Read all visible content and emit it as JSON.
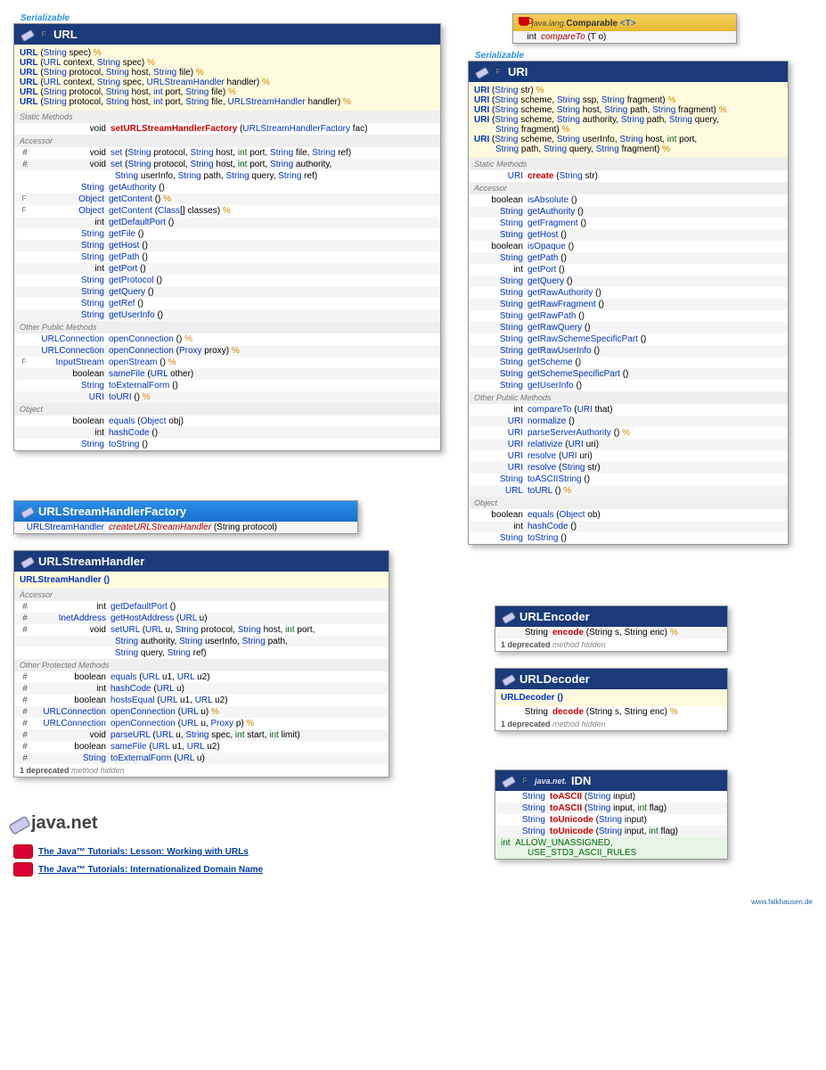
{
  "url_card": {
    "serial": "Serializable",
    "title": "URL",
    "f_marker": "F",
    "constructors": [
      [
        [
          "URL",
          " ("
        ],
        [
          "String",
          " spec) "
        ],
        [
          " %"
        ]
      ],
      [
        [
          "URL",
          " ("
        ],
        [
          "URL",
          " context, "
        ],
        [
          "String",
          " spec) "
        ],
        [
          " %"
        ]
      ],
      [
        [
          "URL",
          " ("
        ],
        [
          "String",
          " protocol, "
        ],
        [
          "String",
          " host, "
        ],
        [
          "String",
          " file) "
        ],
        [
          " %"
        ]
      ],
      [
        [
          "URL",
          " ("
        ],
        [
          "URL",
          " context, "
        ],
        [
          "String",
          " spec, "
        ],
        [
          "URLStreamHandler",
          " handler) "
        ],
        [
          " %"
        ]
      ],
      [
        [
          "URL",
          " ("
        ],
        [
          "String",
          " protocol, "
        ],
        [
          "String",
          " host, "
        ],
        [
          "int",
          " port, "
        ],
        [
          "String",
          " file) "
        ],
        [
          " %"
        ]
      ],
      [
        [
          "URL",
          " ("
        ],
        [
          "String",
          " protocol, "
        ],
        [
          "String",
          " host, "
        ],
        [
          "int",
          " port, "
        ],
        [
          "String",
          " file, "
        ],
        [
          "URLStreamHandler",
          " handler) "
        ],
        [
          " %"
        ]
      ]
    ],
    "static_label": "Static Methods",
    "static_rows": [
      {
        "hash": "",
        "ret": "void",
        "method": "setURLStreamHandlerFactory",
        "red": true,
        "args": " (URLStreamHandlerFactory fac)"
      }
    ],
    "accessor_label": "Accessor",
    "accessor_set": [
      {
        "hash": "#",
        "ret": "void",
        "method": "set",
        "args": " (String protocol, String host, int port, String file, String ref)"
      },
      {
        "hash": "#",
        "ret": "void",
        "method": "set",
        "args": " (String protocol, String host, int port, String authority,",
        "cont": "String userInfo, String path, String query, String ref)"
      }
    ],
    "accessor_rows": [
      {
        "ret": "String",
        "method": "getAuthority",
        "args": " ()"
      },
      {
        "f": "F",
        "ret": "Object",
        "method": "getContent",
        "args": " () ",
        "exc": "%"
      },
      {
        "f": "F",
        "ret": "Object",
        "method": "getContent",
        "args": " (Class[] classes) ",
        "exc": "%"
      },
      {
        "ret": "int",
        "method": "getDefaultPort",
        "args": " ()"
      },
      {
        "ret": "String",
        "method": "getFile",
        "args": " ()"
      },
      {
        "ret": "String",
        "method": "getHost",
        "args": " ()"
      },
      {
        "ret": "String",
        "method": "getPath",
        "args": " ()"
      },
      {
        "ret": "int",
        "method": "getPort",
        "args": " ()"
      },
      {
        "ret": "String",
        "method": "getProtocol",
        "args": " ()"
      },
      {
        "ret": "String",
        "method": "getQuery",
        "args": " ()"
      },
      {
        "ret": "String",
        "method": "getRef",
        "args": " ()"
      },
      {
        "ret": "String",
        "method": "getUserInfo",
        "args": " ()"
      }
    ],
    "other_label": "Other Public Methods",
    "other_rows": [
      {
        "ret": "URLConnection",
        "method": "openConnection",
        "args": " () ",
        "exc": "%"
      },
      {
        "ret": "URLConnection",
        "method": "openConnection",
        "args": " (Proxy proxy) ",
        "exc": "%"
      },
      {
        "f": "F",
        "ret": "InputStream",
        "method": "openStream",
        "args": " () ",
        "exc": "%"
      },
      {
        "ret": "boolean",
        "retg": true,
        "method": "sameFile",
        "args": " (URL other)"
      },
      {
        "ret": "String",
        "method": "toExternalForm",
        "args": " ()"
      },
      {
        "ret": "URI",
        "method": "toURI",
        "args": " () ",
        "exc": "%"
      }
    ],
    "object_label": "Object",
    "object_rows": [
      {
        "ret": "boolean",
        "retg": true,
        "method": "equals",
        "args": " (Object obj)"
      },
      {
        "ret": "int",
        "method": "hashCode",
        "args": " ()"
      },
      {
        "ret": "String",
        "method": "toString",
        "args": " ()"
      }
    ]
  },
  "factory_card": {
    "title": "URLStreamHandlerFactory",
    "row": {
      "ret": "URLStreamHandler",
      "method": "createURLStreamHandler",
      "args": " (String protocol)"
    }
  },
  "handler_card": {
    "title": "URLStreamHandler",
    "ctor": "URLStreamHandler ()",
    "accessor_label": "Accessor",
    "accessor_rows": [
      {
        "hash": "#",
        "ret": "int",
        "method": "getDefaultPort",
        "args": " ()"
      },
      {
        "hash": "#",
        "ret": "InetAddress",
        "method": "getHostAddress",
        "args": " (URL u)"
      },
      {
        "hash": "#",
        "ret": "void",
        "method": "setURL",
        "args": " (URL u, String protocol, String host, int port,",
        "cont": "String authority, String userInfo, String path,",
        "cont2": "String query, String ref)"
      }
    ],
    "other_label": "Other Protected Methods",
    "other_rows": [
      {
        "hash": "#",
        "ret": "boolean",
        "retg": true,
        "method": "equals",
        "args": " (URL u1, URL u2)"
      },
      {
        "hash": "#",
        "ret": "int",
        "method": "hashCode",
        "args": " (URL u)"
      },
      {
        "hash": "#",
        "ret": "boolean",
        "retg": true,
        "method": "hostsEqual",
        "args": " (URL u1, URL u2)"
      },
      {
        "hash": "#",
        "ret": "URLConnection",
        "method": "openConnection",
        "args": " (URL u) ",
        "exc": "%"
      },
      {
        "hash": "#",
        "ret": "URLConnection",
        "method": "openConnection",
        "args": " (URL u, Proxy p) ",
        "exc": "%"
      },
      {
        "hash": "#",
        "ret": "void",
        "method": "parseURL",
        "args": " (URL u, String spec, int start, int limit)"
      },
      {
        "hash": "#",
        "ret": "boolean",
        "retg": true,
        "method": "sameFile",
        "args": " (URL u1, URL u2)"
      },
      {
        "hash": "#",
        "ret": "String",
        "method": "toExternalForm",
        "args": " (URL u)"
      }
    ],
    "dep": "1 deprecated method hidden"
  },
  "comparable": {
    "prefix": "java.lang.",
    "title": "Comparable",
    "gen": "<T>",
    "row": {
      "ret": "int",
      "method": "compareTo",
      "args": " (T o)"
    }
  },
  "uri_card": {
    "serial": "Serializable",
    "title": "URI",
    "f_marker": "F",
    "constructors": [
      "URI (String str) %",
      "URI (String scheme, String ssp, String fragment) %",
      "URI (String scheme, String host, String path, String fragment) %",
      "URI (String scheme, String authority, String path, String query,\n    String fragment) %",
      "URI (String scheme, String userInfo, String host, int port,\n    String path, String query, String fragment) %"
    ],
    "static_label": "Static Methods",
    "static_rows": [
      {
        "ret": "URI",
        "method": "create",
        "red": true,
        "args": " (String str)"
      }
    ],
    "accessor_label": "Accessor",
    "accessor_rows": [
      {
        "ret": "boolean",
        "retg": true,
        "method": "isAbsolute",
        "args": " ()"
      },
      {
        "ret": "String",
        "method": "getAuthority",
        "args": " ()"
      },
      {
        "ret": "String",
        "method": "getFragment",
        "args": " ()"
      },
      {
        "ret": "String",
        "method": "getHost",
        "args": " ()"
      },
      {
        "ret": "boolean",
        "retg": true,
        "method": "isOpaque",
        "args": " ()"
      },
      {
        "ret": "String",
        "method": "getPath",
        "args": " ()"
      },
      {
        "ret": "int",
        "method": "getPort",
        "args": " ()"
      },
      {
        "ret": "String",
        "method": "getQuery",
        "args": " ()"
      },
      {
        "ret": "String",
        "method": "getRawAuthority",
        "args": " ()"
      },
      {
        "ret": "String",
        "method": "getRawFragment",
        "args": " ()"
      },
      {
        "ret": "String",
        "method": "getRawPath",
        "args": " ()"
      },
      {
        "ret": "String",
        "method": "getRawQuery",
        "args": " ()"
      },
      {
        "ret": "String",
        "method": "getRawSchemeSpecificPart",
        "args": " ()"
      },
      {
        "ret": "String",
        "method": "getRawUserInfo",
        "args": " ()"
      },
      {
        "ret": "String",
        "method": "getScheme",
        "args": " ()"
      },
      {
        "ret": "String",
        "method": "getSchemeSpecificPart",
        "args": " ()"
      },
      {
        "ret": "String",
        "method": "getUserInfo",
        "args": " ()"
      }
    ],
    "other_label": "Other Public Methods",
    "other_rows": [
      {
        "ret": "int",
        "method": "compareTo",
        "args": " (URI that)"
      },
      {
        "ret": "URI",
        "method": "normalize",
        "args": " ()"
      },
      {
        "ret": "URI",
        "method": "parseServerAuthority",
        "args": " () ",
        "exc": "%"
      },
      {
        "ret": "URI",
        "method": "relativize",
        "args": " (URI uri)"
      },
      {
        "ret": "URI",
        "method": "resolve",
        "args": " (URI uri)"
      },
      {
        "ret": "URI",
        "method": "resolve",
        "args": " (String str)"
      },
      {
        "ret": "String",
        "method": "toASCIIString",
        "args": " ()"
      },
      {
        "ret": "URL",
        "method": "toURL",
        "args": " () ",
        "exc": "%"
      }
    ],
    "object_label": "Object",
    "object_rows": [
      {
        "ret": "boolean",
        "retg": true,
        "method": "equals",
        "args": " (Object ob)"
      },
      {
        "ret": "int",
        "method": "hashCode",
        "args": " ()"
      },
      {
        "ret": "String",
        "method": "toString",
        "args": " ()"
      }
    ]
  },
  "encoder": {
    "title": "URLEncoder",
    "row": {
      "ret": "String",
      "method": "encode",
      "red": true,
      "args": " (String s, String enc) ",
      "exc": "%"
    },
    "dep": "1 deprecated method hidden"
  },
  "decoder": {
    "title": "URLDecoder",
    "ctor": "URLDecoder ()",
    "row": {
      "ret": "String",
      "method": "decode",
      "red": true,
      "args": " (String s, String enc) ",
      "exc": "%"
    },
    "dep": "1 deprecated method hidden"
  },
  "idn": {
    "prefix": "java.net.",
    "title": "IDN",
    "f_marker": "F",
    "rows": [
      {
        "ret": "String",
        "method": "toASCII",
        "red": true,
        "args": " (String input)"
      },
      {
        "ret": "String",
        "method": "toASCII",
        "red": true,
        "args": " (String input, int flag)"
      },
      {
        "ret": "String",
        "method": "toUnicode",
        "red": true,
        "args": " (String input)"
      },
      {
        "ret": "String",
        "method": "toUnicode",
        "red": true,
        "args": " (String input, int flag)"
      }
    ],
    "consts": "int  ALLOW_UNASSIGNED,\n     USE_STD3_ASCII_RULES"
  },
  "pkg": "java.net",
  "links": [
    "The Java™ Tutorials: Lesson: Working with URLs",
    "The Java™ Tutorials: Internationalized Domain Name"
  ],
  "attrib": "www.falkhausen.de"
}
